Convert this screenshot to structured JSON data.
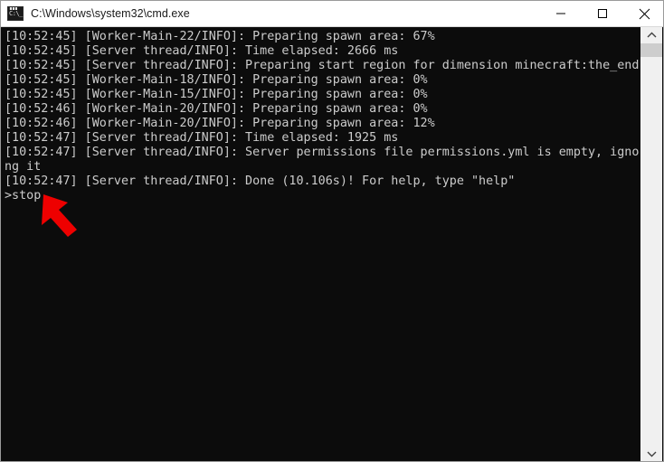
{
  "window": {
    "title": "C:\\Windows\\system32\\cmd.exe",
    "icon_name": "cmd-icon",
    "icon_glyph": "C:\\_",
    "background_color": "#0c0c0c",
    "text_color": "#cccccc",
    "titlebar_color": "#ffffff",
    "border_color": "#9a9a9a"
  },
  "controls": {
    "minimize_label": "Minimize",
    "maximize_label": "Maximize",
    "close_label": "Close"
  },
  "console": {
    "lines": [
      "[10:52:45] [Worker-Main-22/INFO]: Preparing spawn area: 67%",
      "[10:52:45] [Server thread/INFO]: Time elapsed: 2666 ms",
      "[10:52:45] [Server thread/INFO]: Preparing start region for dimension minecraft:the_end",
      "[10:52:45] [Worker-Main-18/INFO]: Preparing spawn area: 0%",
      "[10:52:45] [Worker-Main-15/INFO]: Preparing spawn area: 0%",
      "[10:52:46] [Worker-Main-20/INFO]: Preparing spawn area: 0%",
      "[10:52:46] [Worker-Main-20/INFO]: Preparing spawn area: 12%",
      "[10:52:47] [Server thread/INFO]: Time elapsed: 1925 ms",
      "[10:52:47] [Server thread/INFO]: Server permissions file permissions.yml is empty, ignori",
      "ng it",
      "[10:52:47] [Server thread/INFO]: Done (10.106s)! For help, type \"help\"",
      ">stop"
    ],
    "text": "[10:52:45] [Worker-Main-22/INFO]: Preparing spawn area: 67%\n[10:52:45] [Server thread/INFO]: Time elapsed: 2666 ms\n[10:52:45] [Server thread/INFO]: Preparing start region for dimension minecraft:the_end\n[10:52:45] [Worker-Main-18/INFO]: Preparing spawn area: 0%\n[10:52:45] [Worker-Main-15/INFO]: Preparing spawn area: 0%\n[10:52:46] [Worker-Main-20/INFO]: Preparing spawn area: 0%\n[10:52:46] [Worker-Main-20/INFO]: Preparing spawn area: 12%\n[10:52:47] [Server thread/INFO]: Time elapsed: 1925 ms\n[10:52:47] [Server thread/INFO]: Server permissions file permissions.yml is empty, ignori\nng it\n[10:52:47] [Server thread/INFO]: Done (10.106s)! For help, type \"help\"\n>stop",
    "prompt_command": "stop"
  },
  "scrollbar": {
    "up_arrow": "scroll-up",
    "down_arrow": "scroll-down",
    "thumb_position_percent": 3
  },
  "annotation": {
    "arrow_color": "#ee0000",
    "arrow_points_to": "stop"
  }
}
